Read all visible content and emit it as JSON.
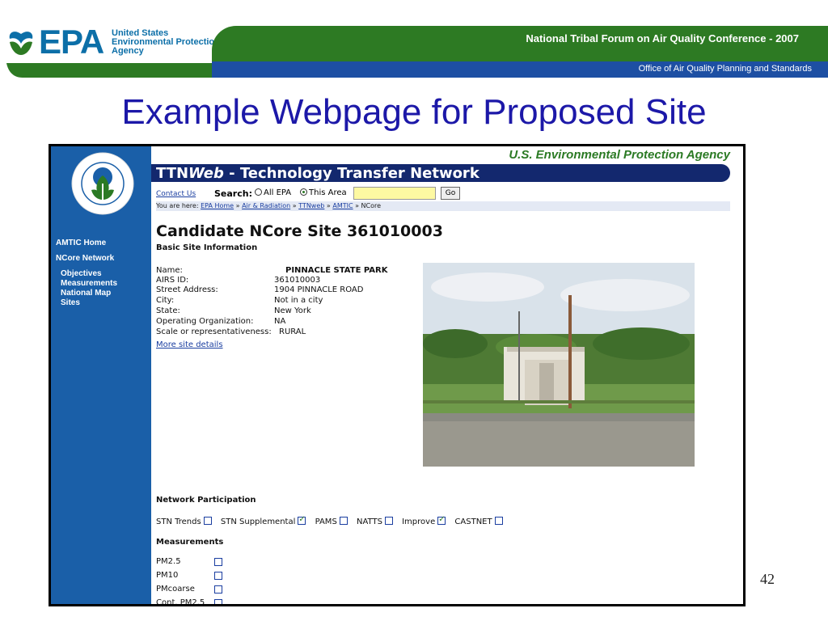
{
  "header": {
    "logo_letters": "EPA",
    "logo_agency": [
      "United States",
      "Environmental Protection",
      "Agency"
    ],
    "conference": "National Tribal Forum on Air Quality Conference - 2007",
    "office": "Office of Air Quality Planning and Standards",
    "colors": {
      "green": "#2d7a23",
      "blue": "#1d4fa3",
      "title": "#1c18a8"
    }
  },
  "slide_title": "Example Webpage for Proposed Site",
  "page_number": "42",
  "web": {
    "agency": "U.S. Environmental Protection Agency",
    "ttn_prefix": "TTN",
    "ttn_web": "Web",
    "ttn_suffix": " - Technology Transfer Network",
    "contact": "Contact Us",
    "search_label": "Search:",
    "search_all": "All EPA",
    "search_area": "This Area",
    "search_value": "",
    "go": "Go",
    "crumbs_prefix": "You are here: ",
    "crumbs": [
      "EPA Home",
      "Air & Radiation",
      "TTNweb",
      "AMTIC"
    ],
    "crumbs_current": "NCore",
    "sidebar": {
      "home": "AMTIC Home",
      "network": "NCore Network",
      "items": [
        "Objectives",
        "Measurements",
        "National Map",
        "Sites"
      ]
    },
    "site_title": "Candidate NCore Site 361010003",
    "basic_heading": "Basic Site Information",
    "info_labels": [
      "Name:",
      "AIRS ID:",
      "Street Address:",
      "City:",
      "State:",
      "Operating Organization:",
      "Scale or representativeness:"
    ],
    "info_values": [
      "PINNACLE STATE PARK",
      "361010003",
      "1904 PINNACLE ROAD",
      "Not in a city",
      "New York",
      "NA",
      "RURAL"
    ],
    "more": "More site details",
    "network_heading": "Network Participation",
    "networks": [
      {
        "label": "STN Trends",
        "checked": false
      },
      {
        "label": "STN Supplemental",
        "checked": true
      },
      {
        "label": "PAMS",
        "checked": false
      },
      {
        "label": "NATTS",
        "checked": false
      },
      {
        "label": "Improve",
        "checked": true
      },
      {
        "label": "CASTNET",
        "checked": false
      }
    ],
    "measurements_heading": "Measurements",
    "measurements": [
      "PM2.5",
      "PM10",
      "PMcoarse",
      "Cont. PM2.5"
    ]
  }
}
